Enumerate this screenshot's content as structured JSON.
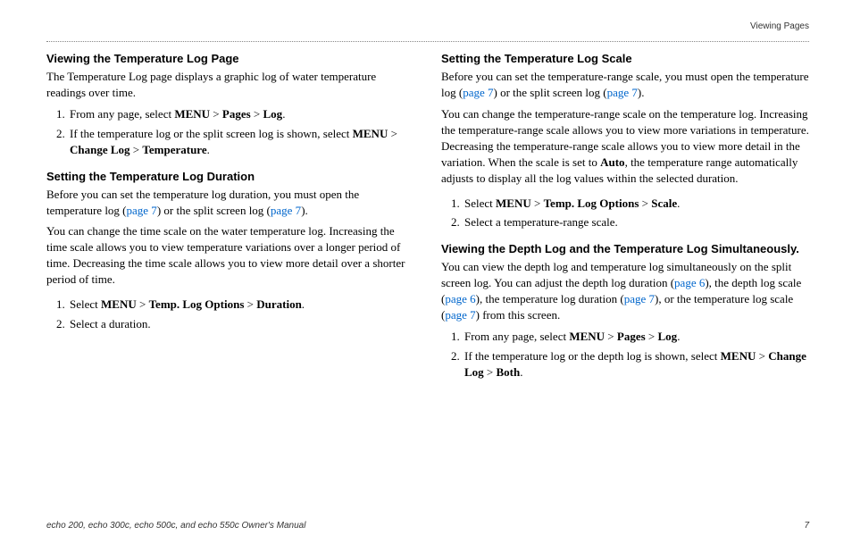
{
  "running_head": "Viewing Pages",
  "footer_manual": "echo 200, echo 300c, echo 500c, and echo 550c Owner's Manual",
  "footer_page": "7",
  "left": {
    "h1": "Viewing the Temperature Log Page",
    "p1": "The Temperature Log page displays a graphic log of water temperature readings over time.",
    "li1a": "From any page, select ",
    "li1_menu": "MENU",
    "li1_gt1": " > ",
    "li1_pages": "Pages",
    "li1_gt2": " > ",
    "li1_log": "Log",
    "li1_end": ".",
    "li2a": "If the temperature log or the split screen log is shown, select ",
    "li2_menu": "MENU",
    "li2_gt1": " > ",
    "li2_change": "Change Log",
    "li2_gt2": " > ",
    "li2_temp": "Temperature",
    "li2_end": ".",
    "h2": "Setting the Temperature Log Duration",
    "p2a": "Before you can set the temperature log duration, you must open the temperature log (",
    "p2link1": "page 7",
    "p2b": ") or the split screen log (",
    "p2link2": "page 7",
    "p2c": ").",
    "p3": "You can change the time scale on the water temperature log. Increasing the time scale allows you to view temperature variations over a longer period of time. Decreasing the time scale allows you to view more detail over a shorter period of time.",
    "li3a": "Select ",
    "li3_menu": "MENU",
    "li3_gt1": " > ",
    "li3_tlo": "Temp. Log Options",
    "li3_gt2": " > ",
    "li3_dur": "Duration",
    "li3_end": ".",
    "li4": "Select a duration."
  },
  "right": {
    "h1": "Setting the Temperature Log Scale",
    "p1a": "Before you can set the temperature-range scale, you must open the temperature log (",
    "p1link1": "page 7",
    "p1b": ") or the split screen log (",
    "p1link2": "page 7",
    "p1c": ").",
    "p2a": "You can change the temperature-range scale on the temperature log. Increasing the temperature-range scale allows you to view more variations in temperature. Decreasing the temperature-range scale allows you to view more detail in the variation. When the scale is set to ",
    "p2_auto": "Auto",
    "p2b": ", the temperature range automatically adjusts to display all the log values within the selected duration.",
    "li1a": "Select ",
    "li1_menu": "MENU",
    "li1_gt1": " > ",
    "li1_tlo": "Temp. Log Options",
    "li1_gt2": " > ",
    "li1_scale": "Scale",
    "li1_end": ".",
    "li2": "Select a temperature-range scale.",
    "h2": "Viewing the Depth Log and the Temperature Log Simultaneously.",
    "p3a": "You can view the depth log and temperature log simultaneously on the split screen log. You can adjust the depth log duration (",
    "p3link1": "page 6",
    "p3b": "), the depth log scale (",
    "p3link2": "page 6",
    "p3c": "), the temperature log duration (",
    "p3link3": "page 7",
    "p3d": "), or the temperature log scale (",
    "p3link4": "page 7",
    "p3e": ") from this screen.",
    "li3a": "From any page, select ",
    "li3_menu": "MENU",
    "li3_gt1": " > ",
    "li3_pages": "Pages",
    "li3_gt2": " > ",
    "li3_log": "Log",
    "li3_end": ".",
    "li4a": "If the temperature log or the depth log is shown, select ",
    "li4_menu": "MENU",
    "li4_gt1": " > ",
    "li4_change": "Change Log",
    "li4_gt2": " > ",
    "li4_both": "Both",
    "li4_end": "."
  }
}
